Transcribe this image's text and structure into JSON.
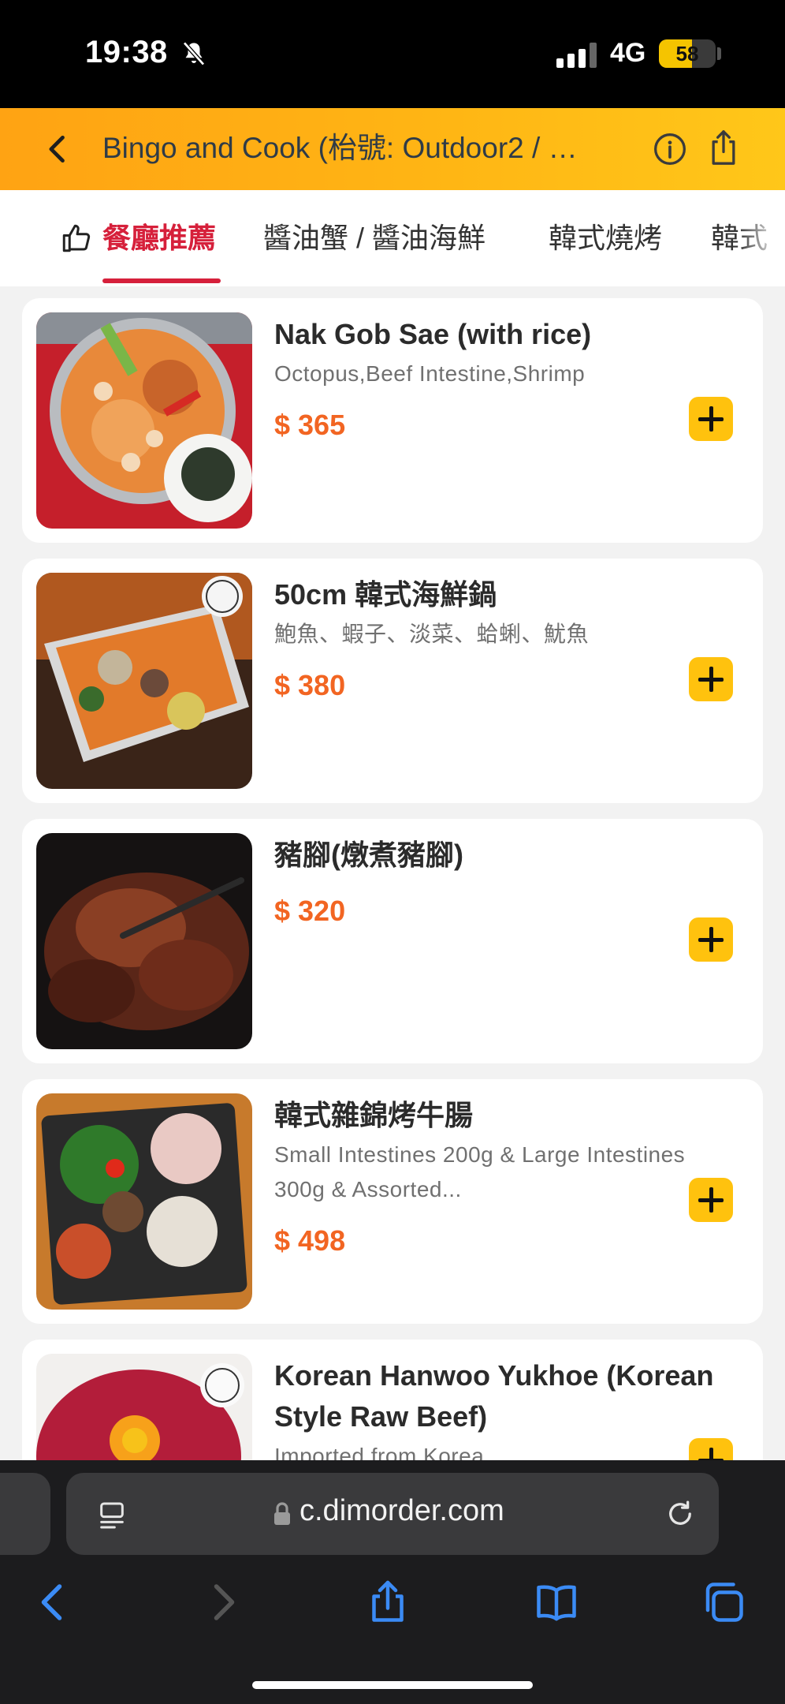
{
  "status_bar": {
    "time": "19:38",
    "network": "4G",
    "battery_level": "58",
    "battery_fraction": 0.58,
    "icons": [
      "bell-slash-icon",
      "signal-icon",
      "battery-icon"
    ]
  },
  "header": {
    "title": "Bingo and Cook (枱號: Outdoor2 / …",
    "icons": [
      "chevron-left-icon",
      "info-icon",
      "share-icon"
    ],
    "gradient": [
      "#ffa313",
      "#ffc719"
    ]
  },
  "tabs": [
    {
      "label": "餐廳推薦",
      "active": true,
      "icon": "thumbs-up-icon"
    },
    {
      "label": "醬油蟹 / 醬油海鮮",
      "active": false
    },
    {
      "label": "韓式燒烤",
      "active": false
    },
    {
      "label": "韓式",
      "active": false
    }
  ],
  "menu_items": [
    {
      "name": "Nak Gob Sae (with rice)",
      "description": "Octopus,Beef Intestine,Shrimp",
      "price": "$ 365"
    },
    {
      "name": "50cm 韓式海鮮鍋",
      "description": "鮑魚、蝦子、淡菜、蛤蜊、魷魚",
      "price": "$ 380"
    },
    {
      "name": "豬腳(燉煮豬腳)",
      "description": "",
      "price": "$ 320"
    },
    {
      "name": "韓式雜錦烤牛腸",
      "description": "Small Intestines 200g & Large Intestines 300g & Assorted...",
      "price": "$ 498"
    },
    {
      "name": "Korean Hanwoo Yukhoe (Korean Style Raw Beef)",
      "description": "Imported from Korea",
      "price": ""
    }
  ],
  "colors": {
    "accent_red": "#d6203b",
    "price_orange": "#f26522",
    "add_button": "#ffc20e"
  },
  "browser": {
    "url": "c.dimorder.com",
    "icons": [
      "reader-icon",
      "lock-icon",
      "reload-icon",
      "back-icon",
      "forward-icon",
      "share-icon",
      "bookmarks-icon",
      "tabs-icon"
    ]
  }
}
